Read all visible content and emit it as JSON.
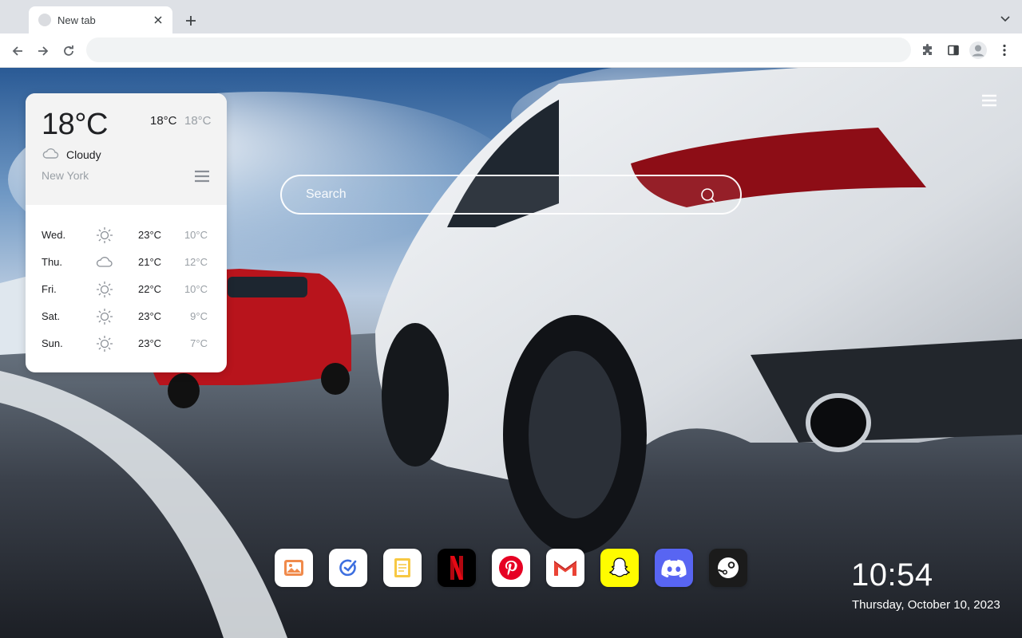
{
  "browser": {
    "tab_title": "New tab",
    "omnibox_value": "",
    "colors": {
      "chrome": "#dee1e6",
      "toolbar": "#ffffff",
      "omnibox": "#f1f3f4"
    }
  },
  "weather": {
    "current_temp": "18°C",
    "high": "18°C",
    "low": "18°C",
    "condition": "Cloudy",
    "condition_icon": "cloud-icon",
    "city": "New York",
    "forecast": [
      {
        "day": "Wed.",
        "icon": "sun-icon",
        "high": "23°C",
        "low": "10°C"
      },
      {
        "day": "Thu.",
        "icon": "cloud-icon",
        "high": "21°C",
        "low": "12°C"
      },
      {
        "day": "Fri.",
        "icon": "sun-icon",
        "high": "22°C",
        "low": "10°C"
      },
      {
        "day": "Sat.",
        "icon": "sun-icon",
        "high": "23°C",
        "low": "9°C"
      },
      {
        "day": "Sun.",
        "icon": "sun-icon",
        "high": "23°C",
        "low": "7°C"
      }
    ]
  },
  "search": {
    "placeholder": "Search"
  },
  "dock": [
    {
      "name": "gallery-app",
      "icon": "image-icon",
      "bg": "#ffffff"
    },
    {
      "name": "tasks-app",
      "icon": "check-icon",
      "bg": "#ffffff"
    },
    {
      "name": "notes-app",
      "icon": "notes-icon",
      "bg": "#ffffff"
    },
    {
      "name": "netflix",
      "icon": "netflix-icon",
      "bg": "#000000"
    },
    {
      "name": "pinterest",
      "icon": "pinterest-icon",
      "bg": "#ffffff"
    },
    {
      "name": "gmail",
      "icon": "gmail-icon",
      "bg": "#ffffff"
    },
    {
      "name": "snapchat",
      "icon": "snapchat-icon",
      "bg": "#fffc00"
    },
    {
      "name": "discord",
      "icon": "discord-icon",
      "bg": "#5865f2"
    },
    {
      "name": "steam",
      "icon": "steam-icon",
      "bg": "#1b1b1b"
    }
  ],
  "clock": {
    "time": "10:54",
    "date": "Thursday, October 10, 2023"
  }
}
